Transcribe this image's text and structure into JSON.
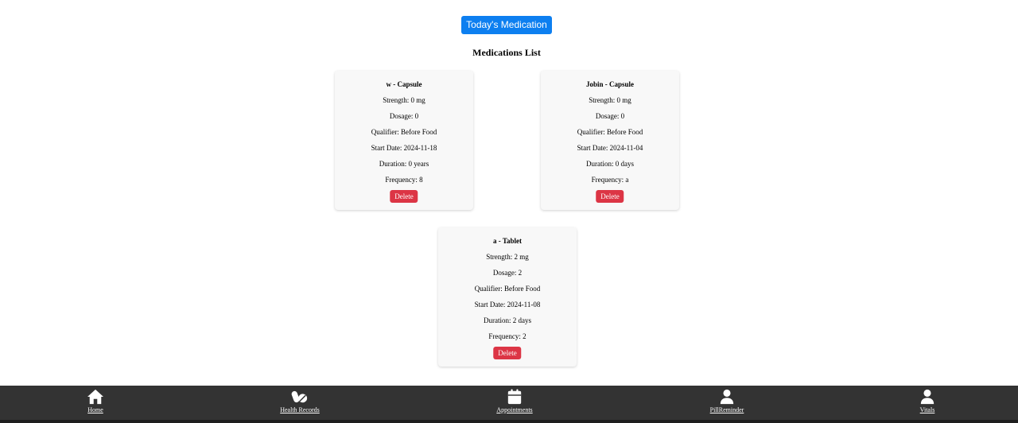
{
  "header": {
    "today_button": "Today's Medication",
    "list_title": "Medications List"
  },
  "cards": [
    {
      "title": "w - Capsule",
      "strength": "Strength: 0 mg",
      "dosage": "Dosage: 0",
      "qualifier": "Qualifier: Before Food",
      "start_date": "Start Date: 2024-11-18",
      "duration": "Duration: 0 years",
      "frequency": "Frequency: 8",
      "delete_label": "Delete"
    },
    {
      "title": "Jobin - Capsule",
      "strength": "Strength: 0 mg",
      "dosage": "Dosage: 0",
      "qualifier": "Qualifier: Before Food",
      "start_date": "Start Date: 2024-11-04",
      "duration": "Duration: 0 days",
      "frequency": "Frequency: a",
      "delete_label": "Delete"
    },
    {
      "title": "a - Tablet",
      "strength": "Strength: 2 mg",
      "dosage": "Dosage: 2",
      "qualifier": "Qualifier: Before Food",
      "start_date": "Start Date: 2024-11-08",
      "duration": "Duration: 2 days",
      "frequency": "Frequency: 2",
      "delete_label": "Delete"
    }
  ],
  "nav": {
    "items": [
      {
        "label": "Home",
        "icon": "home-icon"
      },
      {
        "label": "Health Records",
        "icon": "pills-icon"
      },
      {
        "label": "Appointments",
        "icon": "calendar-icon"
      },
      {
        "label": "PillReminder",
        "icon": "user-icon"
      },
      {
        "label": "Vitals",
        "icon": "user-icon"
      }
    ]
  },
  "colors": {
    "primary": "#0d7ff0",
    "danger": "#dc3545",
    "navbar": "#333333",
    "card_bg": "#f8f8f8"
  }
}
